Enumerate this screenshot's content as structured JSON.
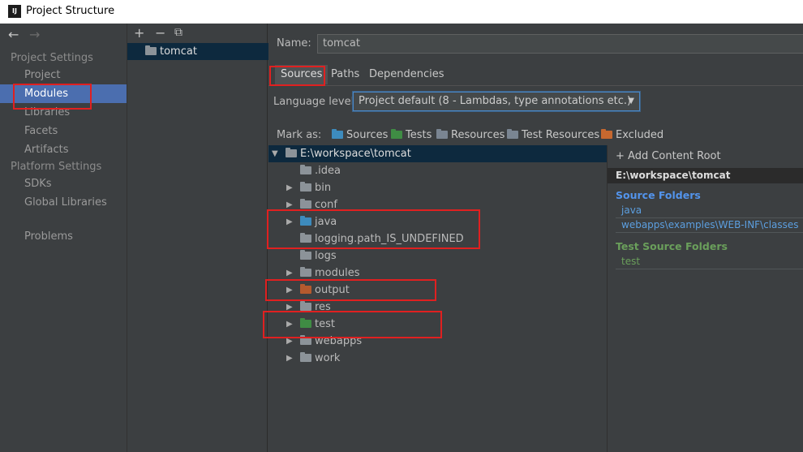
{
  "window": {
    "title": "Project Structure",
    "app_icon": "IJ"
  },
  "nav": {
    "project_settings": "Project Settings",
    "items": [
      "Project",
      "Modules",
      "Libraries",
      "Facets",
      "Artifacts"
    ],
    "platform_settings": "Platform Settings",
    "platform_items": [
      "SDKs",
      "Global Libraries"
    ],
    "problems": "Problems"
  },
  "modules": {
    "add": "+",
    "remove": "−",
    "copy": "⧉",
    "items": [
      "tomcat"
    ]
  },
  "main": {
    "name_label": "Name:",
    "name_value": "tomcat",
    "tabs": [
      "Sources",
      "Paths",
      "Dependencies"
    ],
    "language_level_label": "Language level:",
    "language_level_value": "Project default (8 - Lambdas, type annotations etc.)",
    "mark_as_label": "Mark as:",
    "mark_as": [
      "Sources",
      "Tests",
      "Resources",
      "Test Resources",
      "Excluded"
    ]
  },
  "tree": {
    "root": "E:\\workspace\\tomcat",
    "children": [
      ".idea",
      "bin",
      "conf",
      "java",
      "logging.path_IS_UNDEFINED",
      "logs",
      "modules",
      "output",
      "res",
      "test",
      "webapps",
      "work"
    ]
  },
  "content_root": {
    "add_label": "+ Add Content Root",
    "path": "E:\\workspace\\tomcat",
    "source_folders_label": "Source Folders",
    "source_folders": [
      "java",
      "webapps\\examples\\WEB-INF\\classes"
    ],
    "test_source_folders_label": "Test Source Folders",
    "test_source_folders": [
      "test"
    ]
  }
}
